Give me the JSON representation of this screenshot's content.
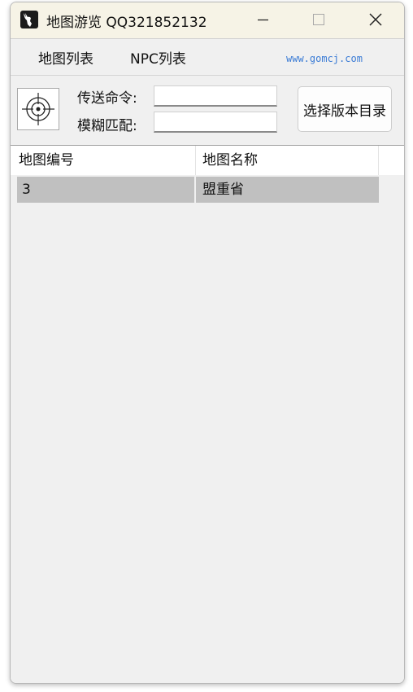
{
  "window": {
    "title": "地图游览 QQ321852132"
  },
  "menu": {
    "items": [
      "地图列表",
      "NPC列表"
    ],
    "website": "www.gomcj.com"
  },
  "toolbar": {
    "teleport_label": "传送命令:",
    "teleport_value": "",
    "fuzzy_label": "模糊匹配:",
    "fuzzy_value": "",
    "select_button": "选择版本目录"
  },
  "table": {
    "columns": [
      "地图编号",
      "地图名称"
    ],
    "rows": [
      {
        "id": "3",
        "name": "盟重省",
        "selected": true
      }
    ]
  },
  "icons": {
    "app": "deer-head-icon",
    "target": "crosshair-icon"
  }
}
